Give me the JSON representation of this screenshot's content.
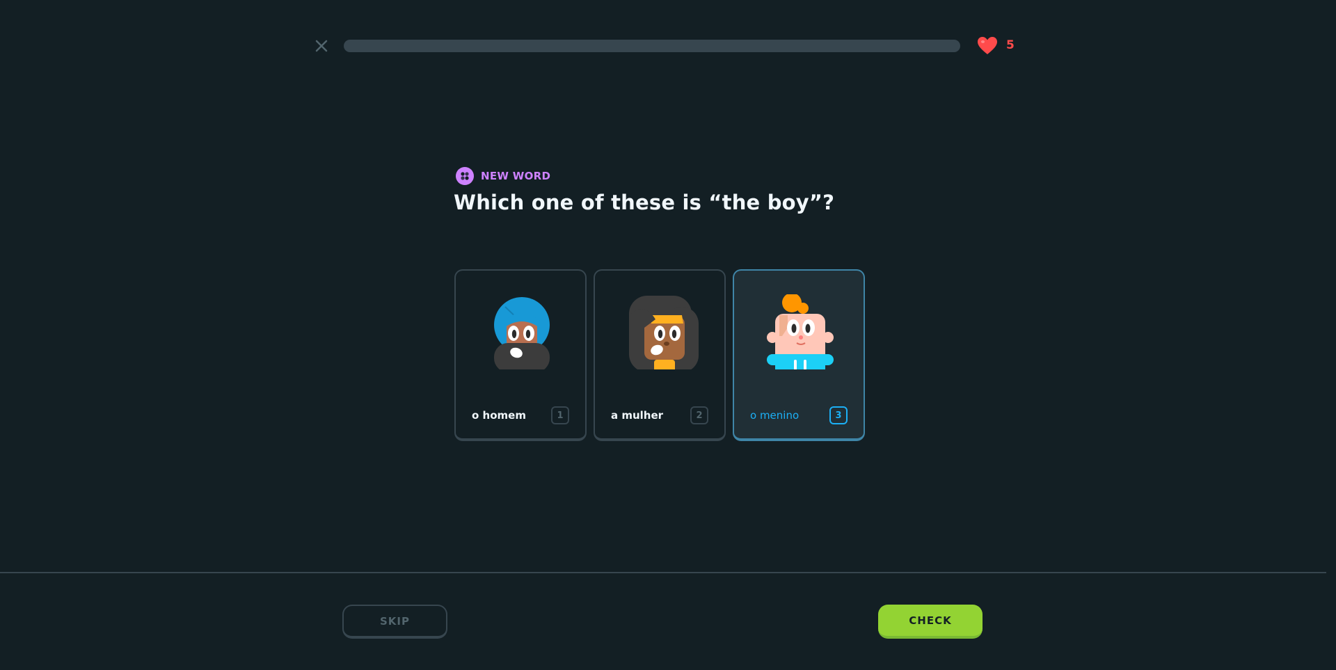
{
  "progress": {
    "value": 0
  },
  "hearts": {
    "count": "5",
    "color": "#ff4b4b"
  },
  "challenge": {
    "badge_label": "NEW WORD",
    "question": "Which one of these is “the boy”?"
  },
  "choices": [
    {
      "label": "o homem",
      "key": "1",
      "selected": false,
      "image": "man-with-turban-illustration"
    },
    {
      "label": "a mulher",
      "key": "2",
      "selected": false,
      "image": "woman-illustration"
    },
    {
      "label": "o menino",
      "key": "3",
      "selected": true,
      "image": "boy-illustration"
    }
  ],
  "footer": {
    "skip_label": "SKIP",
    "check_label": "CHECK"
  },
  "colors": {
    "background": "#131f24",
    "accent_green": "#93d333",
    "accent_blue": "#1cb0f6",
    "badge_purple": "#ce82ff",
    "border": "#37464f"
  }
}
